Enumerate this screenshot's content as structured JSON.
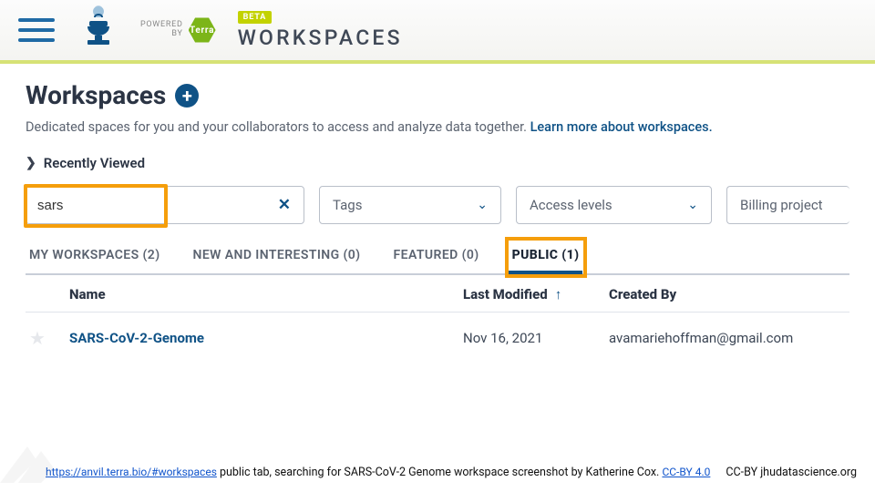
{
  "topbar": {
    "powered_by_l1": "POWERED",
    "powered_by_l2": "BY",
    "terra_badge": "Terra",
    "beta": "BETA",
    "banner_title": "WORKSPACES"
  },
  "heading": {
    "title": "Workspaces",
    "subtext": "Dedicated spaces for you and your collaborators to access and analyze data together.",
    "learn_more": "Learn more about workspaces."
  },
  "recent": {
    "label": "Recently Viewed"
  },
  "filters": {
    "search_value": "sars",
    "tags": "Tags",
    "access": "Access levels",
    "billing": "Billing project"
  },
  "tabs": [
    {
      "label": "MY WORKSPACES (2)",
      "active": false
    },
    {
      "label": "NEW AND INTERESTING (0)",
      "active": false
    },
    {
      "label": "FEATURED (0)",
      "active": false
    },
    {
      "label": "PUBLIC (1)",
      "active": true
    }
  ],
  "table": {
    "headers": {
      "name": "Name",
      "modified": "Last Modified",
      "created_by": "Created By"
    },
    "rows": [
      {
        "name": "SARS-CoV-2-Genome",
        "modified": "Nov 16, 2021",
        "created_by": "avamariehoffman@gmail.com"
      }
    ]
  },
  "caption": {
    "url": "https://anvil.terra.bio/#workspaces",
    "text": " public  tab, searching for  SARS-CoV-2 Genome workspace screenshot by Katherine Cox.  ",
    "cc_link": "CC-BY 4.0",
    "right": "CC-BY  jhudatascience.org"
  }
}
